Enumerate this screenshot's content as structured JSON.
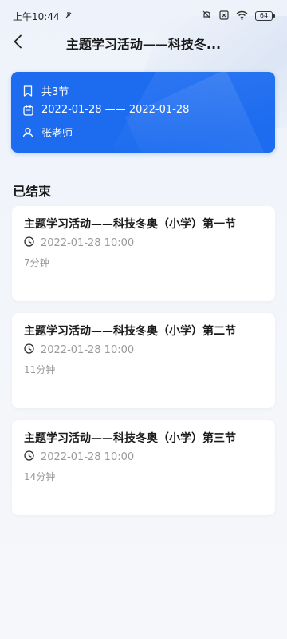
{
  "status_bar": {
    "time": "上午10:44",
    "battery": "64"
  },
  "header": {
    "title": "主题学习活动——科技冬..."
  },
  "info": {
    "lessons_count": "共3节",
    "date_range": "2022-01-28 —— 2022-01-28",
    "teacher": "张老师"
  },
  "section": {
    "title": "已结束"
  },
  "lessons": [
    {
      "title": "主题学习活动——科技冬奥（小学）第一节",
      "time": "2022-01-28 10:00",
      "duration": "7分钟"
    },
    {
      "title": "主题学习活动——科技冬奥（小学）第二节",
      "time": "2022-01-28 10:00",
      "duration": "11分钟"
    },
    {
      "title": "主题学习活动——科技冬奥（小学）第三节",
      "time": "2022-01-28 10:00",
      "duration": "14分钟"
    }
  ],
  "colors": {
    "accent": "#1d6cf0",
    "background": "#f2f5fa",
    "muted_text": "#9a9a9a"
  }
}
